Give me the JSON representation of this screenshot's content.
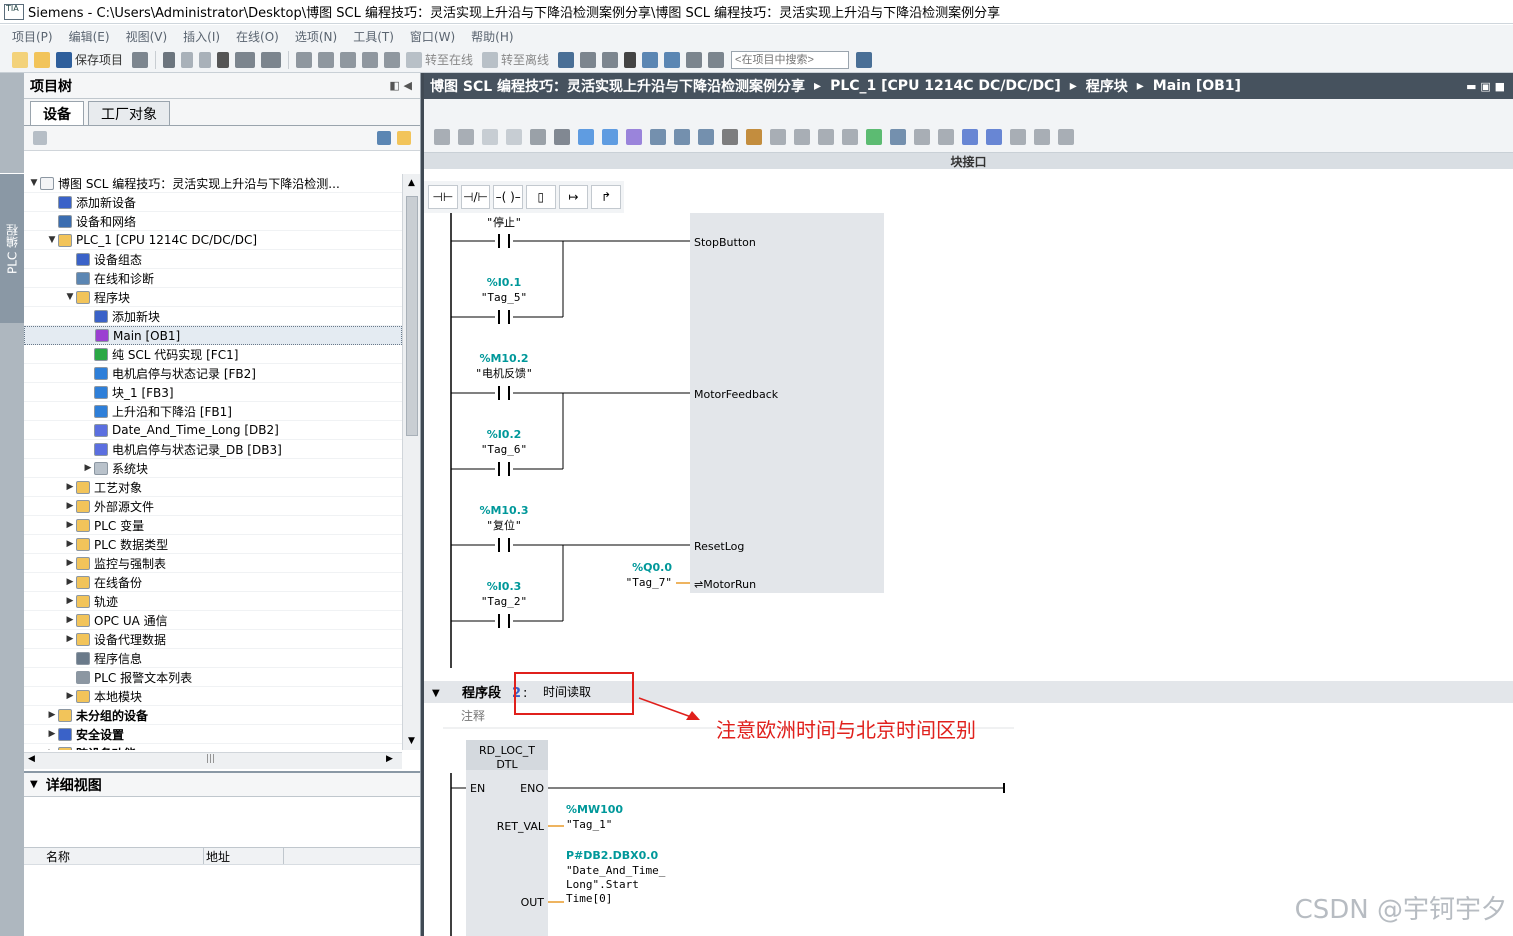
{
  "window": {
    "title": "Siemens  -  C:\\Users\\Administrator\\Desktop\\博图 SCL 编程技巧：灵活实现上升沿与下降沿检测案例分享\\博图 SCL 编程技巧：灵活实现上升沿与下降沿检测案例分享",
    "logo": "TIA"
  },
  "menu": [
    "项目(P)",
    "编辑(E)",
    "视图(V)",
    "插入(I)",
    "在线(O)",
    "选项(N)",
    "工具(T)",
    "窗口(W)",
    "帮助(H)"
  ],
  "toolbar": {
    "save_label": "保存项目",
    "go_online_label": "转至在线",
    "go_offline_label": "转至离线",
    "search_placeholder": "<在项目中搜索>"
  },
  "sidestrip": {
    "tab_label": "PLC 编程"
  },
  "project_tree": {
    "title": "项目树",
    "tabs": [
      "设备",
      "工厂对象"
    ],
    "items": [
      {
        "label": "博图 SCL 编程技巧：灵活实现上升沿与下降沿检测...",
        "level": 0,
        "tw": "▼",
        "color": "#f3f4f6"
      },
      {
        "label": "添加新设备",
        "level": 1,
        "tw": "",
        "color": "#3a62c8"
      },
      {
        "label": "设备和网络",
        "level": 1,
        "tw": "",
        "color": "#3b6db0"
      },
      {
        "label": "PLC_1 [CPU 1214C DC/DC/DC]",
        "level": 1,
        "tw": "▼",
        "color": "#f2c45a"
      },
      {
        "label": "设备组态",
        "level": 2,
        "tw": "",
        "color": "#3a62c8"
      },
      {
        "label": "在线和诊断",
        "level": 2,
        "tw": "",
        "color": "#5b86b3"
      },
      {
        "label": "程序块",
        "level": 2,
        "tw": "▼",
        "color": "#f2c45a"
      },
      {
        "label": "添加新块",
        "level": 3,
        "tw": "",
        "color": "#3a62c8"
      },
      {
        "label": "Main [OB1]",
        "level": 3,
        "tw": "",
        "color": "#9b3fd1"
      },
      {
        "label": "纯 SCL 代码实现 [FC1]",
        "level": 3,
        "tw": "",
        "color": "#2aa845"
      },
      {
        "label": "电机启停与状态记录 [FB2]",
        "level": 3,
        "tw": "",
        "color": "#2e7fd9"
      },
      {
        "label": "块_1 [FB3]",
        "level": 3,
        "tw": "",
        "color": "#2e7fd9"
      },
      {
        "label": "上升沿和下降沿 [FB1]",
        "level": 3,
        "tw": "",
        "color": "#2e7fd9"
      },
      {
        "label": "Date_And_Time_Long [DB2]",
        "level": 3,
        "tw": "",
        "color": "#5b6fe0"
      },
      {
        "label": "电机启停与状态记录_DB [DB3]",
        "level": 3,
        "tw": "",
        "color": "#5b6fe0"
      },
      {
        "label": "系统块",
        "level": 3,
        "tw": "▶",
        "color": "#b9c2cb"
      },
      {
        "label": "工艺对象",
        "level": 2,
        "tw": "▶",
        "color": "#f2c45a"
      },
      {
        "label": "外部源文件",
        "level": 2,
        "tw": "▶",
        "color": "#f2c45a"
      },
      {
        "label": "PLC 变量",
        "level": 2,
        "tw": "▶",
        "color": "#f2c45a"
      },
      {
        "label": "PLC 数据类型",
        "level": 2,
        "tw": "▶",
        "color": "#f2c45a"
      },
      {
        "label": "监控与强制表",
        "level": 2,
        "tw": "▶",
        "color": "#f2c45a"
      },
      {
        "label": "在线备份",
        "level": 2,
        "tw": "▶",
        "color": "#f2c45a"
      },
      {
        "label": "轨迹",
        "level": 2,
        "tw": "▶",
        "color": "#f2c45a"
      },
      {
        "label": "OPC UA 通信",
        "level": 2,
        "tw": "▶",
        "color": "#f2c45a"
      },
      {
        "label": "设备代理数据",
        "level": 2,
        "tw": "▶",
        "color": "#f2c45a"
      },
      {
        "label": "程序信息",
        "level": 2,
        "tw": "",
        "color": "#6a7a8a"
      },
      {
        "label": "PLC 报警文本列表",
        "level": 2,
        "tw": "",
        "color": "#8c97a2"
      },
      {
        "label": "本地模块",
        "level": 2,
        "tw": "▶",
        "color": "#f2c45a"
      },
      {
        "label": "未分组的设备",
        "level": 1,
        "tw": "▶",
        "color": "#f2c45a"
      },
      {
        "label": "安全设置",
        "level": 1,
        "tw": "▶",
        "color": "#3a62c8"
      },
      {
        "label": "跨设备功能",
        "level": 1,
        "tw": "▶",
        "color": "#f2c45a"
      }
    ]
  },
  "detail_view": {
    "title": "详细视图",
    "columns": [
      "名称",
      "地址"
    ]
  },
  "editor": {
    "breadcrumb": [
      "博图 SCL 编程技巧：灵活实现上升沿与下降沿检测案例分享",
      "PLC_1 [CPU 1214C DC/DC/DC]",
      "程序块",
      "Main [OB1]"
    ],
    "interface_label": "块接口",
    "ladder_tools": [
      "⊣⊢",
      "⊣/⊢",
      "–( )–",
      "▯",
      "↦",
      "↱"
    ]
  },
  "network1": {
    "contacts": [
      {
        "addr": "",
        "tag": "\"停止\""
      },
      {
        "addr": "%I0.1",
        "tag": "\"Tag_5\""
      },
      {
        "addr": "%M10.2",
        "tag": "\"电机反馈\""
      },
      {
        "addr": "%I0.2",
        "tag": "\"Tag_6\""
      },
      {
        "addr": "%M10.3",
        "tag": "\"复位\""
      },
      {
        "addr": "%I0.3",
        "tag": "\"Tag_2\""
      }
    ],
    "pins": [
      "StopButton",
      "MotorFeedback",
      "ResetLog",
      "⇌MotorRun"
    ],
    "output": {
      "addr": "%Q0.0",
      "tag": "\"Tag_7\""
    }
  },
  "network2": {
    "title": "程序段",
    "number": "2",
    "colon": ":",
    "name": "时间读取",
    "comment": "注释",
    "annotation": "注意欧洲时间与北京时间区别",
    "block": {
      "name": "RD_LOC_T",
      "type": "DTL",
      "en": "EN",
      "eno": "ENO",
      "ret_val": "RET_VAL",
      "out": "OUT",
      "ret_addr": "%MW100",
      "ret_tag": "\"Tag_1\"",
      "out_addr": "P#DB2.DBX0.0",
      "out_tag": [
        "\"Date_And_Time_",
        "Long\".Start",
        "Time[0]"
      ]
    }
  },
  "watermark": "CSDN @宇钶宇夕",
  "colors": {
    "address": "#00989a",
    "annotation": "#e0201c",
    "pin_wire": "#e89a2a",
    "header_dark": "#46525e"
  }
}
